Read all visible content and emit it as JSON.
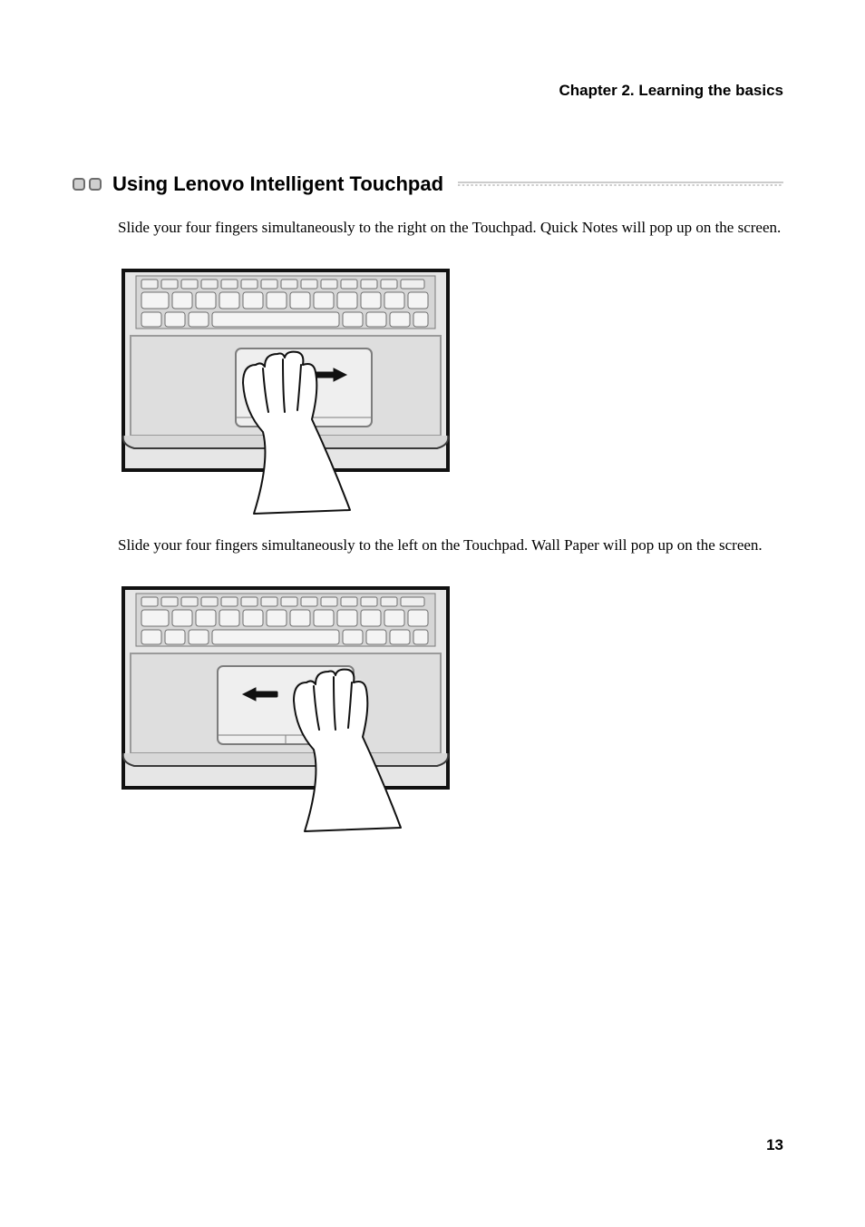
{
  "chapterHeader": "Chapter 2. Learning the basics",
  "section": {
    "title": "Using Lenovo Intelligent Touchpad"
  },
  "paragraphs": {
    "swipeRight": "Slide your four fingers simultaneously to the right on the Touchpad. Quick Notes will pop up on the screen.",
    "swipeLeft": "Slide your four fingers simultaneously to the left on the Touchpad. Wall Paper will pop up on the screen."
  },
  "pageNumber": "13"
}
